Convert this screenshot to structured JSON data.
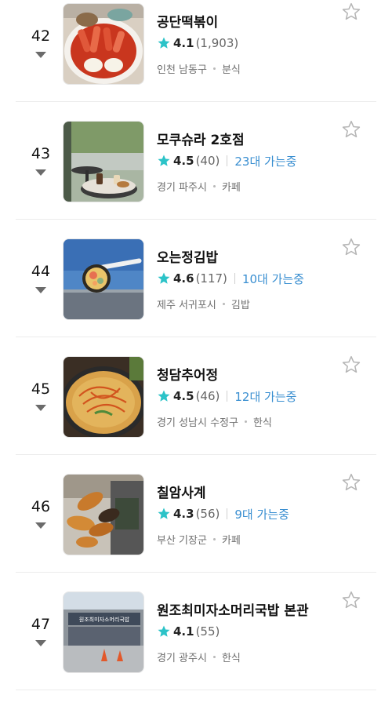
{
  "items": [
    {
      "rank": "42",
      "trend": "down",
      "name": "공단떡볶이",
      "score": "4.1",
      "count": "(1,903)",
      "visiting": "",
      "region": "인천 남동구",
      "category": "분식",
      "thumb": "tteokbokki"
    },
    {
      "rank": "43",
      "trend": "down",
      "name": "모쿠슈라 2호점",
      "score": "4.5",
      "count": "(40)",
      "visiting": "23대 가는중",
      "region": "경기 파주시",
      "category": "카페",
      "thumb": "cafe-terrace"
    },
    {
      "rank": "44",
      "trend": "down",
      "name": "오는정김밥",
      "score": "4.6",
      "count": "(117)",
      "visiting": "10대 가는중",
      "region": "제주 서귀포시",
      "category": "김밥",
      "thumb": "gimbap-sky"
    },
    {
      "rank": "45",
      "trend": "down",
      "name": "청담추어정",
      "score": "4.5",
      "count": "(46)",
      "visiting": "12대 가는중",
      "region": "경기 성남시 수정구",
      "category": "한식",
      "thumb": "loach-soup"
    },
    {
      "rank": "46",
      "trend": "down",
      "name": "칠암사계",
      "score": "4.3",
      "count": "(56)",
      "visiting": "9대 가는중",
      "region": "부산 기장군",
      "category": "카페",
      "thumb": "bread"
    },
    {
      "rank": "47",
      "trend": "down",
      "name": "원조최미자소머리국밥 본관",
      "score": "4.1",
      "count": "(55)",
      "visiting": "",
      "region": "경기 광주시",
      "category": "한식",
      "thumb": "storefront",
      "sign_text": "원조최미자소머리국밥"
    }
  ],
  "colors": {
    "star": "#2cc3c8",
    "visiting": "#3a8fd1",
    "favorite_outline": "#b5b5b5"
  },
  "icons": {
    "rating": "star-filled-icon",
    "favorite": "star-outline-icon",
    "trend": "triangle-down-icon"
  }
}
